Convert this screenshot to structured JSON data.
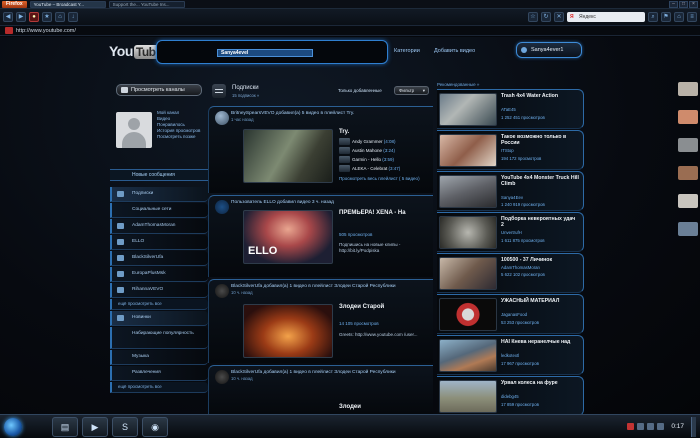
{
  "browser": {
    "menu_label": "Firefox",
    "tabs": [
      {
        "label": "YouTube – Broadcast Y...",
        "active": true
      },
      {
        "label": "Support the... YouTube Ins...",
        "active": false
      }
    ],
    "url": "http://www.youtube.com/",
    "search_placeholder": "Яндекс"
  },
  "header": {
    "logo_you": "You",
    "logo_tube": "Tube",
    "search_value": "Sanya4evel",
    "links": [
      "Категории",
      "Добавить видео"
    ],
    "account_button": "Sanya4ever1"
  },
  "sidebar": {
    "browse_button": "Просмотреть каналы",
    "me_links": [
      "Мой канал",
      "Видео",
      "Понравилось",
      "История просмотров",
      "Посмотреть позже"
    ],
    "messages": "Новые сообщения",
    "items": [
      {
        "label": "Подписки",
        "selected": true
      },
      {
        "label": "Социальные сети",
        "selected": false
      },
      {
        "label": "AdamThomasMoran",
        "selected": false
      },
      {
        "label": "ELLO",
        "selected": false
      },
      {
        "label": "BlackSilverUfa",
        "selected": false
      },
      {
        "label": "EuropaPlusMsk",
        "selected": false
      },
      {
        "label": "RihannaVEVO",
        "selected": false
      }
    ],
    "more_subs": "ещё просмотреть все",
    "section2": [
      {
        "label": "Новинки",
        "selected": true
      },
      {
        "label": "Набирающие популярность",
        "selected": false
      },
      {
        "label": "Музыка",
        "selected": false
      },
      {
        "label": "Развлечения",
        "selected": false
      }
    ],
    "more_cats": "ещё просмотреть все"
  },
  "feed": {
    "title": "Подписки",
    "subtitle": "15 подписок »",
    "filter_label": "Только добавленные",
    "dropdown": "Фильтр",
    "cards": [
      {
        "line": "BritneySpearsVEVO добавил(а) 5 видео в плейлист Try.",
        "time": "1 час назад",
        "title": "Try.",
        "playlist": [
          {
            "name": "Andy Grammer",
            "dur": "(4:08)"
          },
          {
            "name": "Austin Mahone",
            "dur": "(3:24)"
          },
          {
            "name": "Garmin - Hello",
            "dur": "(3:59)"
          },
          {
            "name": "ALEKA - Celebrat",
            "dur": "(3:47)"
          }
        ],
        "view_all": "Просмотреть весь плейлист ( 5 видео)"
      },
      {
        "line": "Пользователь ELLO добавил видео 3 ч. назад",
        "title": "ПРЕМЬЕРА! XENA - На",
        "views": "505 просмотров",
        "desc": "Подпишись на новые клипы - http://bit.ly/Podpiska",
        "thumb_text": "ELLO"
      },
      {
        "line": "BlackSilverUfa добавил(а) 1 видео в плейлист Злодеи Старой Республики",
        "time": "10 ч. назад",
        "title": "Злодеи Старой",
        "views": "14 105 просмотров",
        "desc": "Greets: http://www.youtube.com /user..."
      },
      {
        "line": "BlackSilverUfa добавил(а) 1 видео в плейлист Злодеи Старой Республики",
        "time": "10 ч. назад",
        "title": "Злодеи"
      }
    ]
  },
  "recommendations": {
    "header": "Рекомендованные »",
    "items": [
      {
        "title": "Trash 4x4 Water Action",
        "channel": "ATaE45",
        "views": "1 252 451 просмотров"
      },
      {
        "title": "Такое возможно только в России",
        "channel": "ITStop",
        "views": "194 172 просмотров"
      },
      {
        "title": "YouTube 4x4 Monster Truck Hill Climb",
        "channel": "Sanya4Eev",
        "views": "1 240 919 просмотров"
      },
      {
        "title": "Подборка невероятных удач 2",
        "channel": "UnvertrufH",
        "views": "1 611 875 просмотров"
      },
      {
        "title": "100500 - 37 Личинок",
        "channel": "AdamThomasMoran",
        "views": "5 622 102 просмотров"
      },
      {
        "title": "УЖАСНЫЙ МАТЕРИАЛ",
        "channel": "JaganasFood",
        "views": "53 253 просмотров"
      },
      {
        "title": "HAI Кнева неранелчые над",
        "channel": "ledkotextl",
        "views": "17 967 просмотров"
      },
      {
        "title": "Урвал колеса на фуре",
        "channel": "didebg45",
        "views": "17 859 просмотров"
      }
    ]
  },
  "taskbar": {
    "clock": "0:17",
    "apps": [
      "folder-icon",
      "media-player-icon",
      "skype-icon",
      "firefox-icon"
    ]
  }
}
